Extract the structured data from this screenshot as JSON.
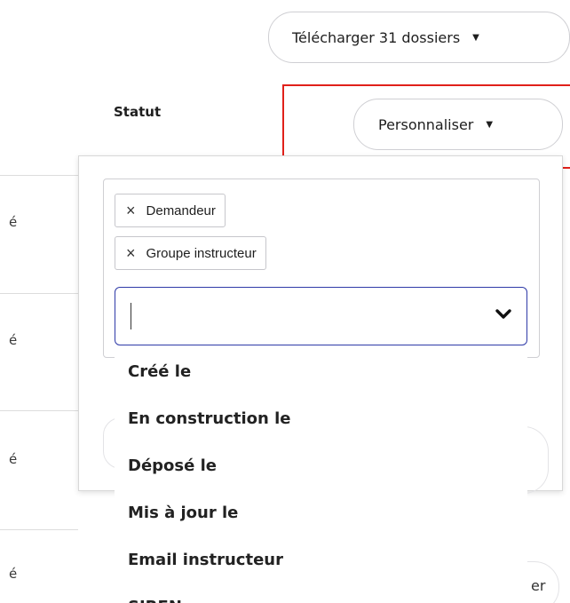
{
  "toolbar": {
    "download_label": "Télécharger 31 dossiers",
    "customize_label": "Personnaliser",
    "caret": "▼"
  },
  "table": {
    "status_header": "Statut",
    "row_fragments": [
      "é",
      "é",
      "é",
      "é"
    ]
  },
  "column_picker": {
    "selected_tags": [
      {
        "label": "Demandeur",
        "remove_glyph": "×"
      },
      {
        "label": "Groupe instructeur",
        "remove_glyph": "×"
      }
    ],
    "input_value": "",
    "options": [
      "Créé le",
      "En construction le",
      "Déposé le",
      "Mis à jour le",
      "Email instructeur",
      "SIREN"
    ]
  },
  "background_buttons": {
    "partial_right_text": "er"
  },
  "colors": {
    "highlight": "#e0201a",
    "input_border": "#2f3aa8"
  }
}
